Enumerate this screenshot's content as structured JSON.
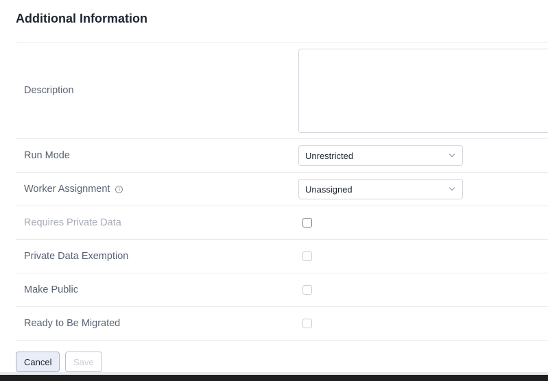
{
  "title": "Additional Information",
  "fields": {
    "description": "Description",
    "run_mode": "Run Mode",
    "run_mode_value": "Unrestricted",
    "worker": "Worker Assignment",
    "worker_value": "Unassigned",
    "requires_private": "Requires Private Data",
    "exemption": "Private Data Exemption",
    "public": "Make Public",
    "migrated": "Ready to Be Migrated"
  },
  "buttons": {
    "cancel": "Cancel",
    "save": "Save"
  }
}
